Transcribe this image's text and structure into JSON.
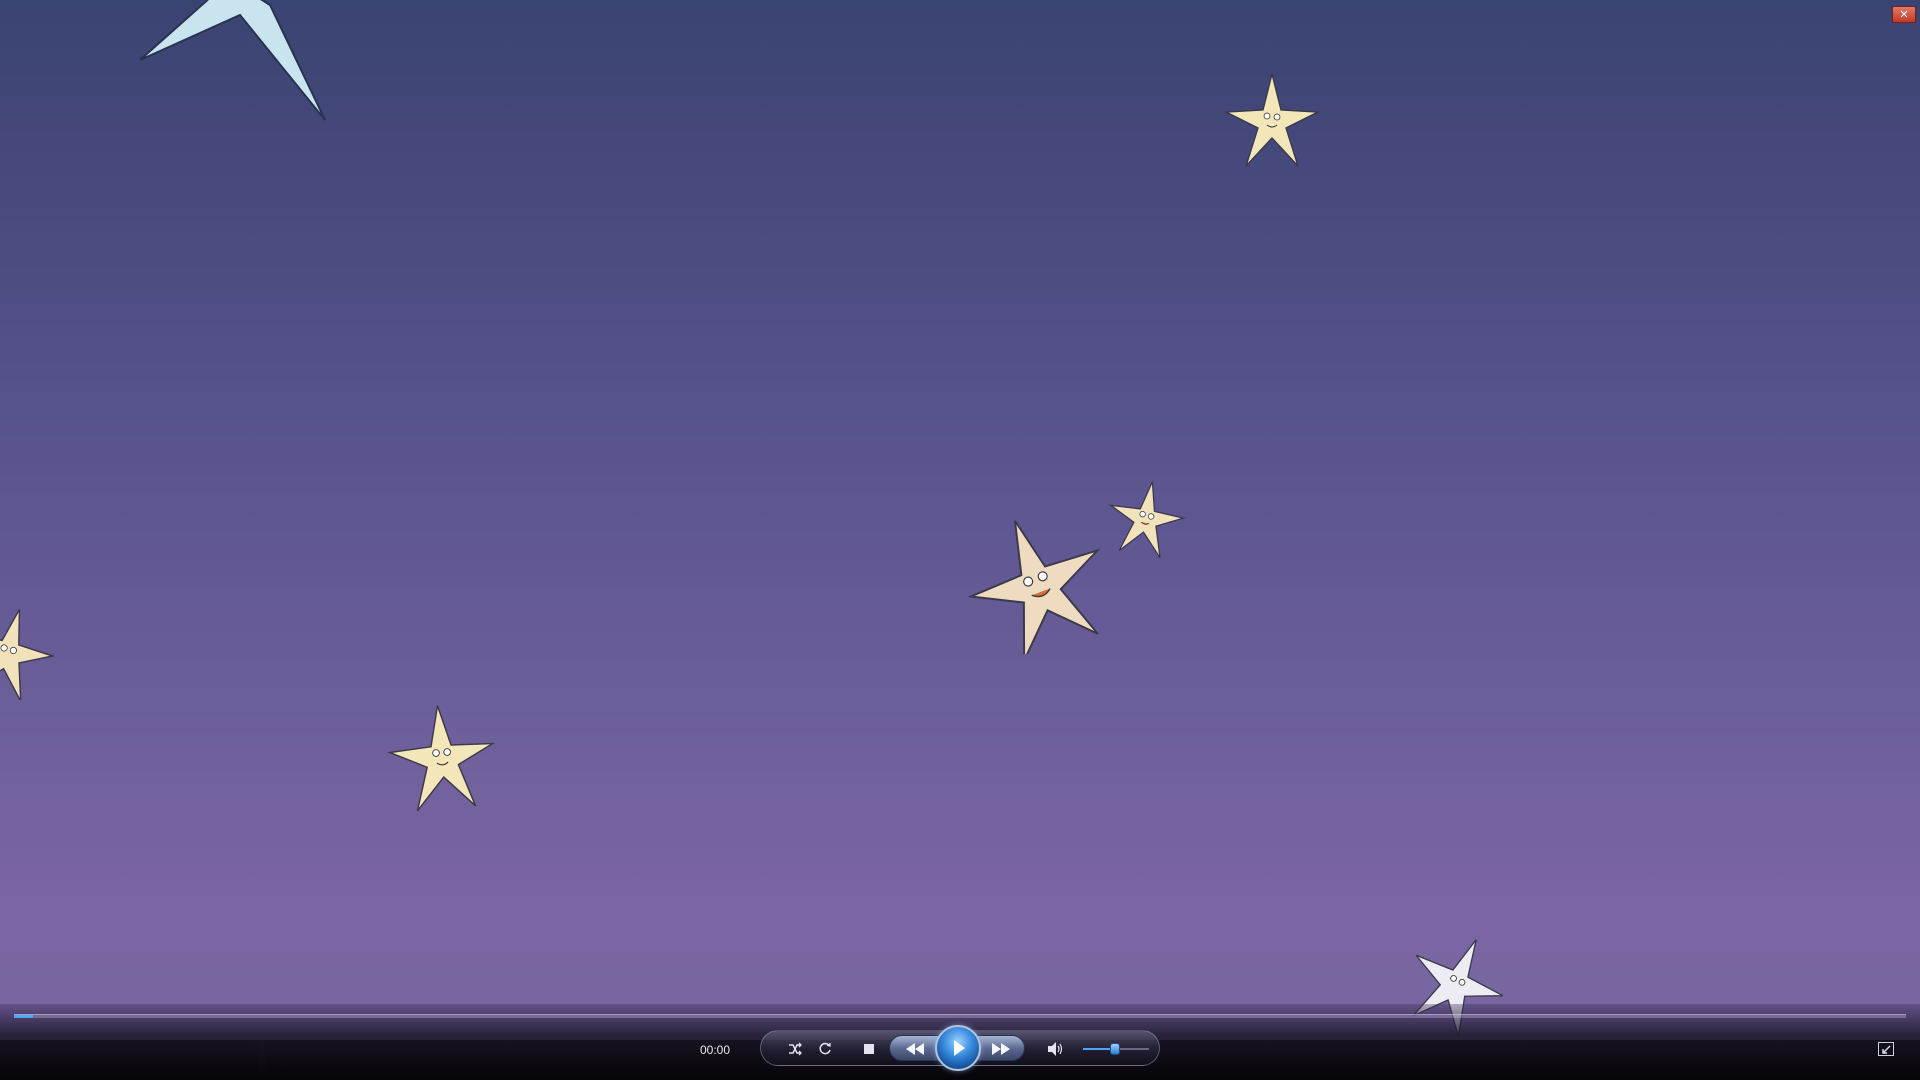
{
  "window": {
    "close_glyph": "✕"
  },
  "video": {
    "background_top": "#3a4472",
    "background_bottom": "#7a66a2",
    "star_colors": [
      "#f3e6b8",
      "#e9dcc0",
      "#c9e4ef",
      "#ececf2"
    ]
  },
  "controls": {
    "time": "00:00",
    "seek_progress": 0.01,
    "volume_level": 0.48,
    "accent_color": "#4ea6ff",
    "buttons": {
      "shuffle_icon": "shuffle-icon",
      "repeat_icon": "repeat-icon",
      "stop_icon": "stop-icon",
      "previous_icon": "rewind-icon",
      "play_icon": "play-icon",
      "next_icon": "fast-forward-icon",
      "mute_icon": "speaker-icon",
      "switch_view_icon": "switch-to-library-icon"
    }
  }
}
